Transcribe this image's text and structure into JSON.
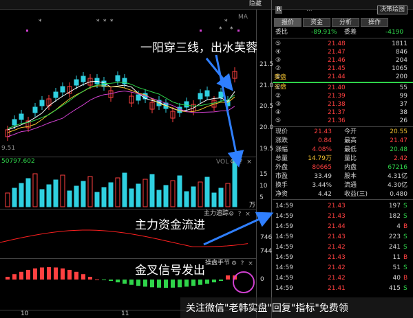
{
  "header": {
    "mode_label": "隐藏",
    "badge": "R",
    "stock_name": "...",
    "button_label": "决策绘图"
  },
  "tabs": [
    "报价",
    "资金",
    "分析",
    "操作"
  ],
  "annotations": {
    "top": "一阳穿三线，出水芙蓉",
    "mid": "主力资金流进",
    "bottom": "金叉信号发出"
  },
  "main_chart": {
    "ma_label": "MA",
    "stars": [
      "*",
      "*",
      "*",
      "*",
      "*",
      "*",
      "*"
    ],
    "price_ticks": [
      "21.5",
      "21.0",
      "20.5",
      "20.0",
      "19.5"
    ],
    "low_label": "9.51"
  },
  "volume_panel": {
    "label": "50797.602",
    "vol_label": "VOL",
    "unit": "万",
    "ticks": [
      "15",
      "10",
      "5"
    ]
  },
  "fund_panel": {
    "title": "主力追踪",
    "ticks": [
      "746",
      "744"
    ]
  },
  "macd_panel": {
    "title": "操盘手节",
    "marker": "0"
  },
  "x_axis": [
    "10",
    "11"
  ],
  "colors": {
    "up": "#ff4040",
    "down": "#2fd0e0",
    "green": "#2fd44a",
    "yellow": "#f0c030",
    "circle": "#d040d0"
  },
  "quote": {
    "wei_bi_label": "委比",
    "wei_bi": "-89.91%",
    "wei_cha_label": "委差",
    "wei_cha": "-4190",
    "sell_label": "卖盘",
    "buy_label": "买盘",
    "sells": [
      {
        "level": "⑤",
        "price": "21.48",
        "vol": "1811"
      },
      {
        "level": "④",
        "price": "21.47",
        "vol": "846"
      },
      {
        "level": "③",
        "price": "21.46",
        "vol": "204"
      },
      {
        "level": "②",
        "price": "21.45",
        "vol": "1065"
      },
      {
        "level": "①",
        "price": "21.44",
        "vol": "200"
      }
    ],
    "buys": [
      {
        "level": "①",
        "price": "21.40",
        "vol": "55"
      },
      {
        "level": "②",
        "price": "21.39",
        "vol": "99"
      },
      {
        "level": "③",
        "price": "21.38",
        "vol": "37"
      },
      {
        "level": "④",
        "price": "21.37",
        "vol": "38"
      },
      {
        "level": "⑤",
        "price": "21.36",
        "vol": "26"
      }
    ],
    "stats": [
      {
        "l1": "现价",
        "v1": "21.43",
        "l2": "今开",
        "v2": "20.55"
      },
      {
        "l1": "涨跌",
        "v1": "0.84",
        "l2": "最高",
        "v2": "21.47"
      },
      {
        "l1": "涨幅",
        "v1": "4.08%",
        "l2": "最低",
        "v2": "20.48"
      },
      {
        "l1": "总量",
        "v1": "14.79万",
        "l2": "量比",
        "v2": "2.42"
      },
      {
        "l1": "外盘",
        "v1": "80665",
        "l2": "内盘",
        "v2": "67216"
      },
      {
        "l1": "市盈",
        "v1": "33.49",
        "l2": "股本",
        "v2": "4.31亿"
      },
      {
        "l1": "换手",
        "v1": "3.44%",
        "l2": "流通",
        "v2": "4.30亿"
      },
      {
        "l1": "净资",
        "v1": "4.42",
        "l2": "收益(三)",
        "v2": "0.480"
      }
    ],
    "ticks": [
      {
        "time": "14:59",
        "price": "21.43",
        "vol": "197",
        "flag": "S"
      },
      {
        "time": "14:59",
        "price": "21.43",
        "vol": "182",
        "flag": "S"
      },
      {
        "time": "14:59",
        "price": "21.44",
        "vol": "4",
        "flag": "B"
      },
      {
        "time": "14:59",
        "price": "21.43",
        "vol": "223",
        "flag": "S"
      },
      {
        "time": "14:59",
        "price": "21.42",
        "vol": "241",
        "flag": "S"
      },
      {
        "time": "14:59",
        "price": "21.43",
        "vol": "11",
        "flag": "B"
      },
      {
        "time": "14:59",
        "price": "21.42",
        "vol": "51",
        "flag": "S"
      },
      {
        "time": "14:59",
        "price": "21.42",
        "vol": "40",
        "flag": "B"
      },
      {
        "time": "14:59",
        "price": "21.41",
        "vol": "415",
        "flag": "S"
      }
    ]
  },
  "watermark": "关注微信\"老韩实盘\"回复\"指标\"免费领"
}
